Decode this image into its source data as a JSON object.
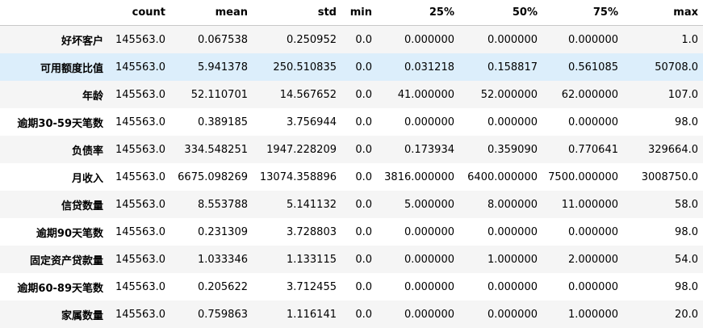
{
  "table": {
    "columns": [
      "",
      "count",
      "mean",
      "std",
      "min",
      "25%",
      "50%",
      "75%",
      "max"
    ],
    "rows": [
      {
        "label": "好坏客户",
        "values": [
          "145563.0",
          "0.067538",
          "0.250952",
          "0.0",
          "0.000000",
          "0.000000",
          "0.000000",
          "1.0"
        ]
      },
      {
        "label": "可用额度比值",
        "values": [
          "145563.0",
          "5.941378",
          "250.510835",
          "0.0",
          "0.031218",
          "0.158817",
          "0.561085",
          "50708.0"
        ]
      },
      {
        "label": "年龄",
        "values": [
          "145563.0",
          "52.110701",
          "14.567652",
          "0.0",
          "41.000000",
          "52.000000",
          "62.000000",
          "107.0"
        ]
      },
      {
        "label": "逾期30-59天笔数",
        "values": [
          "145563.0",
          "0.389185",
          "3.756944",
          "0.0",
          "0.000000",
          "0.000000",
          "0.000000",
          "98.0"
        ]
      },
      {
        "label": "负债率",
        "values": [
          "145563.0",
          "334.548251",
          "1947.228209",
          "0.0",
          "0.173934",
          "0.359090",
          "0.770641",
          "329664.0"
        ]
      },
      {
        "label": "月收入",
        "values": [
          "145563.0",
          "6675.098269",
          "13074.358896",
          "0.0",
          "3816.000000",
          "6400.000000",
          "7500.000000",
          "3008750.0"
        ]
      },
      {
        "label": "信贷数量",
        "values": [
          "145563.0",
          "8.553788",
          "5.141132",
          "0.0",
          "5.000000",
          "8.000000",
          "11.000000",
          "58.0"
        ]
      },
      {
        "label": "逾期90天笔数",
        "values": [
          "145563.0",
          "0.231309",
          "3.728803",
          "0.0",
          "0.000000",
          "0.000000",
          "0.000000",
          "98.0"
        ]
      },
      {
        "label": "固定资产贷款量",
        "values": [
          "145563.0",
          "1.033346",
          "1.133115",
          "0.0",
          "0.000000",
          "1.000000",
          "2.000000",
          "54.0"
        ]
      },
      {
        "label": "逾期60-89天笔数",
        "values": [
          "145563.0",
          "0.205622",
          "3.712455",
          "0.0",
          "0.000000",
          "0.000000",
          "0.000000",
          "98.0"
        ]
      },
      {
        "label": "家属数量",
        "values": [
          "145563.0",
          "0.759863",
          "1.116141",
          "0.0",
          "0.000000",
          "0.000000",
          "1.000000",
          "20.0"
        ]
      }
    ],
    "highlighted_row": 1,
    "colors": {
      "header_border": "#c8c8c8",
      "row_stripe": "#f5f5f5",
      "row_hover": "#dceefb"
    }
  }
}
